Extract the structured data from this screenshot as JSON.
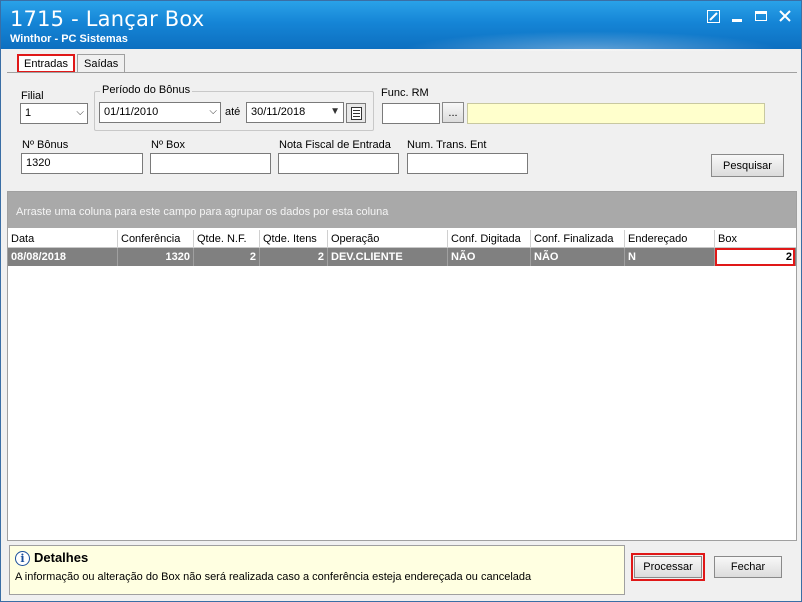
{
  "window": {
    "title": "1715 - Lançar Box",
    "subtitle": "Winthor - PC Sistemas"
  },
  "tabs": [
    {
      "label": "Entradas",
      "active": true
    },
    {
      "label": "Saídas",
      "active": false
    }
  ],
  "filters": {
    "filial_label": "Filial",
    "filial_value": "1",
    "periodo_label": "Período do Bônus",
    "date_from": "01/11/2010",
    "ate_label": "até",
    "date_to": "30/11/2018",
    "func_rm_label": "Func. RM",
    "func_rm_value": "",
    "func_rm_btn": "...",
    "func_rm_name": "",
    "nbonus_label": "Nº Bônus",
    "nbonus_value": "1320",
    "nbox_label": "Nº Box",
    "nbox_value": "",
    "nota_label": "Nota Fiscal de Entrada",
    "nota_value": "",
    "numtrans_label": "Num. Trans. Ent",
    "numtrans_value": "",
    "pesquisar_label": "Pesquisar"
  },
  "grid": {
    "group_hint": "Arraste uma coluna para este campo para agrupar os dados por esta coluna",
    "columns": [
      "Data",
      "Conferência",
      "Qtde. N.F.",
      "Qtde. Itens",
      "Operação",
      "Conf. Digitada",
      "Conf. Finalizada",
      "Endereçado",
      "Box"
    ],
    "rows": [
      [
        "08/08/2018",
        "1320",
        "2",
        "2",
        "DEV.CLIENTE",
        "NÃO",
        "NÃO",
        "N",
        "2"
      ]
    ]
  },
  "details": {
    "title": "Detalhes",
    "text": "A informação ou alteração do Box não será realizada caso a conferência esteja endereçada ou cancelada"
  },
  "buttons": {
    "processar": "Processar",
    "fechar": "Fechar"
  },
  "colors": {
    "titlebar": "#1585d6",
    "highlight": "#e01818",
    "row_selected": "#808080"
  }
}
